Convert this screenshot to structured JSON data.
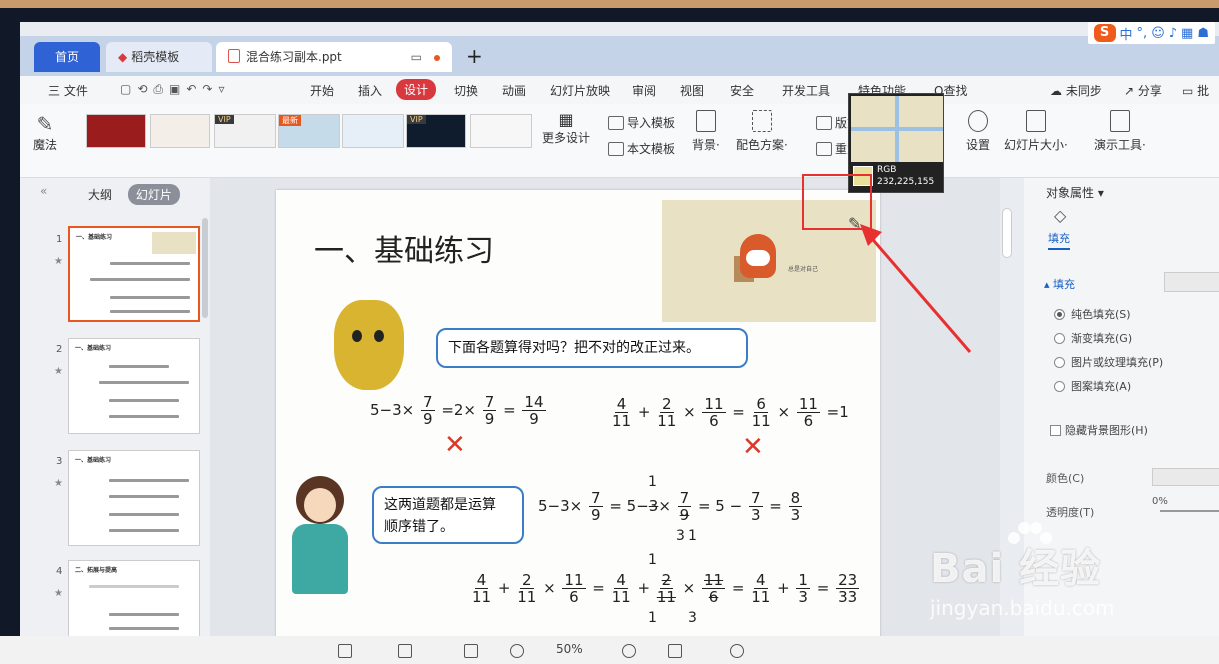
{
  "tabs": {
    "home": "首页",
    "templates": "稻壳模板",
    "document": "混合练习副本.ppt"
  },
  "menu": {
    "file": "三 文件",
    "items": [
      "开始",
      "插入",
      "设计",
      "切换",
      "动画",
      "幻灯片放映",
      "审阅",
      "视图",
      "安全",
      "开发工具",
      "特色功能"
    ],
    "active": "设计",
    "search": "Q查找",
    "sync": "未同步",
    "share": "分享",
    "comment": "批"
  },
  "ribbon": {
    "magic": "魔法",
    "vip": "VIP",
    "new_badge": "最新",
    "more_designs": "更多设计",
    "import_template": "导入模板",
    "this_template": "本文模板",
    "background": "背景",
    "color_scheme": "配色方案",
    "layout": "版式",
    "reset": "重置",
    "settings": "设置",
    "slide_size": "幻灯片大小",
    "presenter_tools": "演示工具"
  },
  "left_panel": {
    "outline_tab": "大纲",
    "slides_tab": "幻灯片",
    "slides": [
      {
        "num": "1",
        "title": "一、基础练习"
      },
      {
        "num": "2",
        "title": "一、基础练习"
      },
      {
        "num": "3",
        "title": "一、基础练习"
      },
      {
        "num": "4",
        "title": "二、拓展与提高"
      }
    ]
  },
  "slide": {
    "title": "一、基础练习",
    "bubble1": "下面各题算得对吗？把不对的改正过来。",
    "bubble2_line1": "这两道题都是运算",
    "bubble2_line2": "顺序错了。",
    "pic_caption": "总是对自己"
  },
  "color_picker": {
    "label": "RGB",
    "value": "232,225,155",
    "swatch": "#e8e19b"
  },
  "right_panel": {
    "title": "对象属性",
    "fill_tab": "填充",
    "fill_section": "填充",
    "options": [
      "纯色填充(S)",
      "渐变填充(G)",
      "图片或纹理填充(P)",
      "图案填充(A)"
    ],
    "hide_bg": "隐藏背景图形(H)",
    "color_label": "颜色(C)",
    "transparency_label": "透明度(T)",
    "transparency_value": "0%"
  },
  "status": {
    "zoom": "50%"
  },
  "watermark": {
    "brand": "Bai  经验",
    "url": "jingyan.baidu.com"
  },
  "ime": {
    "lang": "中"
  }
}
